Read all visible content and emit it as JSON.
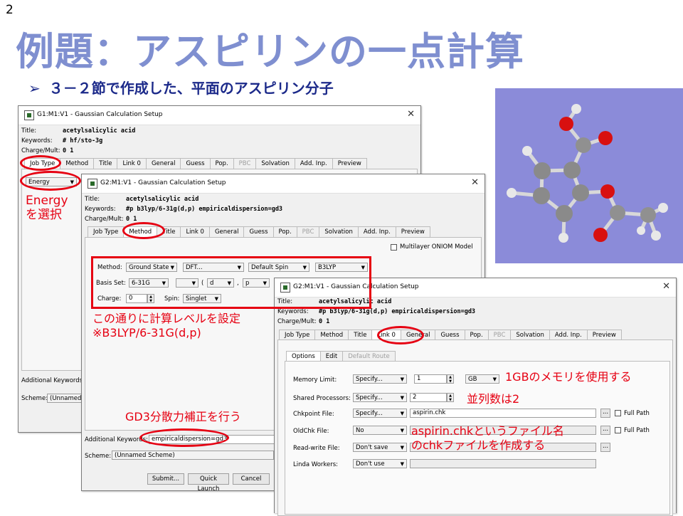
{
  "slide": {
    "number": "2",
    "title": "例題：アスピリンの一点計算",
    "subtitle_bullet": "➢",
    "subtitle": "３－２節で作成した、平面のアスピリン分子"
  },
  "window1": {
    "title": "G1:M1:V1 - Gaussian Calculation Setup",
    "title_label": "Title:",
    "title_value": "acetylsalicylic acid",
    "keywords_label": "Keywords:",
    "keywords_value": "# hf/sto-3g",
    "charge_label": "Charge/Mult:",
    "charge_value": "0 1",
    "tabs": [
      "Job Type",
      "Method",
      "Title",
      "Link 0",
      "General",
      "Guess",
      "Pop.",
      "PBC",
      "Solvation",
      "Add. Inp.",
      "Preview"
    ],
    "job_type_value": "Energy",
    "additional_keywords_label": "Additional Keywords:",
    "scheme_label": "Scheme:",
    "scheme_value": "(Unnamed S"
  },
  "window2": {
    "title": "G2:M1:V1 - Gaussian Calculation Setup",
    "title_label": "Title:",
    "title_value": "acetylsalicylic acid",
    "keywords_label": "Keywords:",
    "keywords_value": "#p b3lyp/6-31g(d,p) empiricaldispersion=gd3",
    "charge_label": "Charge/Mult:",
    "charge_value": "0 1",
    "tabs": [
      "Job Type",
      "Method",
      "Title",
      "Link 0",
      "General",
      "Guess",
      "Pop.",
      "PBC",
      "Solvation",
      "Add. Inp.",
      "Preview"
    ],
    "multilayer_label": "Multilayer ONIOM Model",
    "method_label": "Method:",
    "method_values": [
      "Ground State",
      "DFT...",
      "Default Spin",
      "B3LYP"
    ],
    "basis_label": "Basis Set:",
    "basis_values": [
      "6-31G",
      "",
      "d",
      "p"
    ],
    "basis_sep1": "(",
    "basis_sep2": ",",
    "charge2_label": "Charge:",
    "charge2_value": "0",
    "spin_label": "Spin:",
    "spin_value": "Singlet",
    "additional_keywords_label": "Additional Keywords:",
    "additional_keywords_value": "empiricaldispersion=gd3",
    "scheme_label": "Scheme:",
    "scheme_value": "(Unnamed Scheme)",
    "buttons": [
      "Submit...",
      "Quick Launch",
      "Cancel"
    ]
  },
  "window3": {
    "title": "G2:M1:V1 - Gaussian Calculation Setup",
    "title_label": "Title:",
    "title_value": "acetylsalicylic acid",
    "keywords_label": "Keywords:",
    "keywords_value": "#p b3lyp/6-31g(d,p) empiricaldispersion=gd3",
    "charge_label": "Charge/Mult:",
    "charge_value": "0 1",
    "tabs": [
      "Job Type",
      "Method",
      "Title",
      "Link 0",
      "General",
      "Guess",
      "Pop.",
      "PBC",
      "Solvation",
      "Add. Inp.",
      "Preview"
    ],
    "subtabs": [
      "Options",
      "Edit",
      "Default Route"
    ],
    "memory_label": "Memory Limit:",
    "memory_mode": "Specify...",
    "memory_value": "1",
    "memory_unit": "GB",
    "shared_label": "Shared Processors:",
    "shared_mode": "Specify...",
    "shared_value": "2",
    "chk_label": "Chkpoint File:",
    "chk_mode": "Specify...",
    "chk_value": "aspirin.chk",
    "oldchk_label": "OldChk File:",
    "oldchk_mode": "No",
    "rw_label": "Read-write File:",
    "rw_mode": "Don't save",
    "linda_label": "Linda Workers:",
    "linda_mode": "Don't use",
    "browse": "...",
    "full_path": "Full Path"
  },
  "annotations": {
    "energy": [
      "Energy",
      "を選択"
    ],
    "method": [
      "この通りに計算レベルを設定",
      "※B3LYP/6-31G(d,p)"
    ],
    "gd3": "GD3分散力補正を行う",
    "memory": "1GBのメモリを使用する",
    "parallel": "並列数は2",
    "chk": [
      "aspirin.chkというファイル名",
      "のchkファイルを作成する"
    ]
  },
  "colors": {
    "annotation_red": "#e60012",
    "title_blue": "#7f8fd0",
    "subtitle_navy": "#1c2a8a",
    "molecule_bg": "#8b8bd9"
  }
}
